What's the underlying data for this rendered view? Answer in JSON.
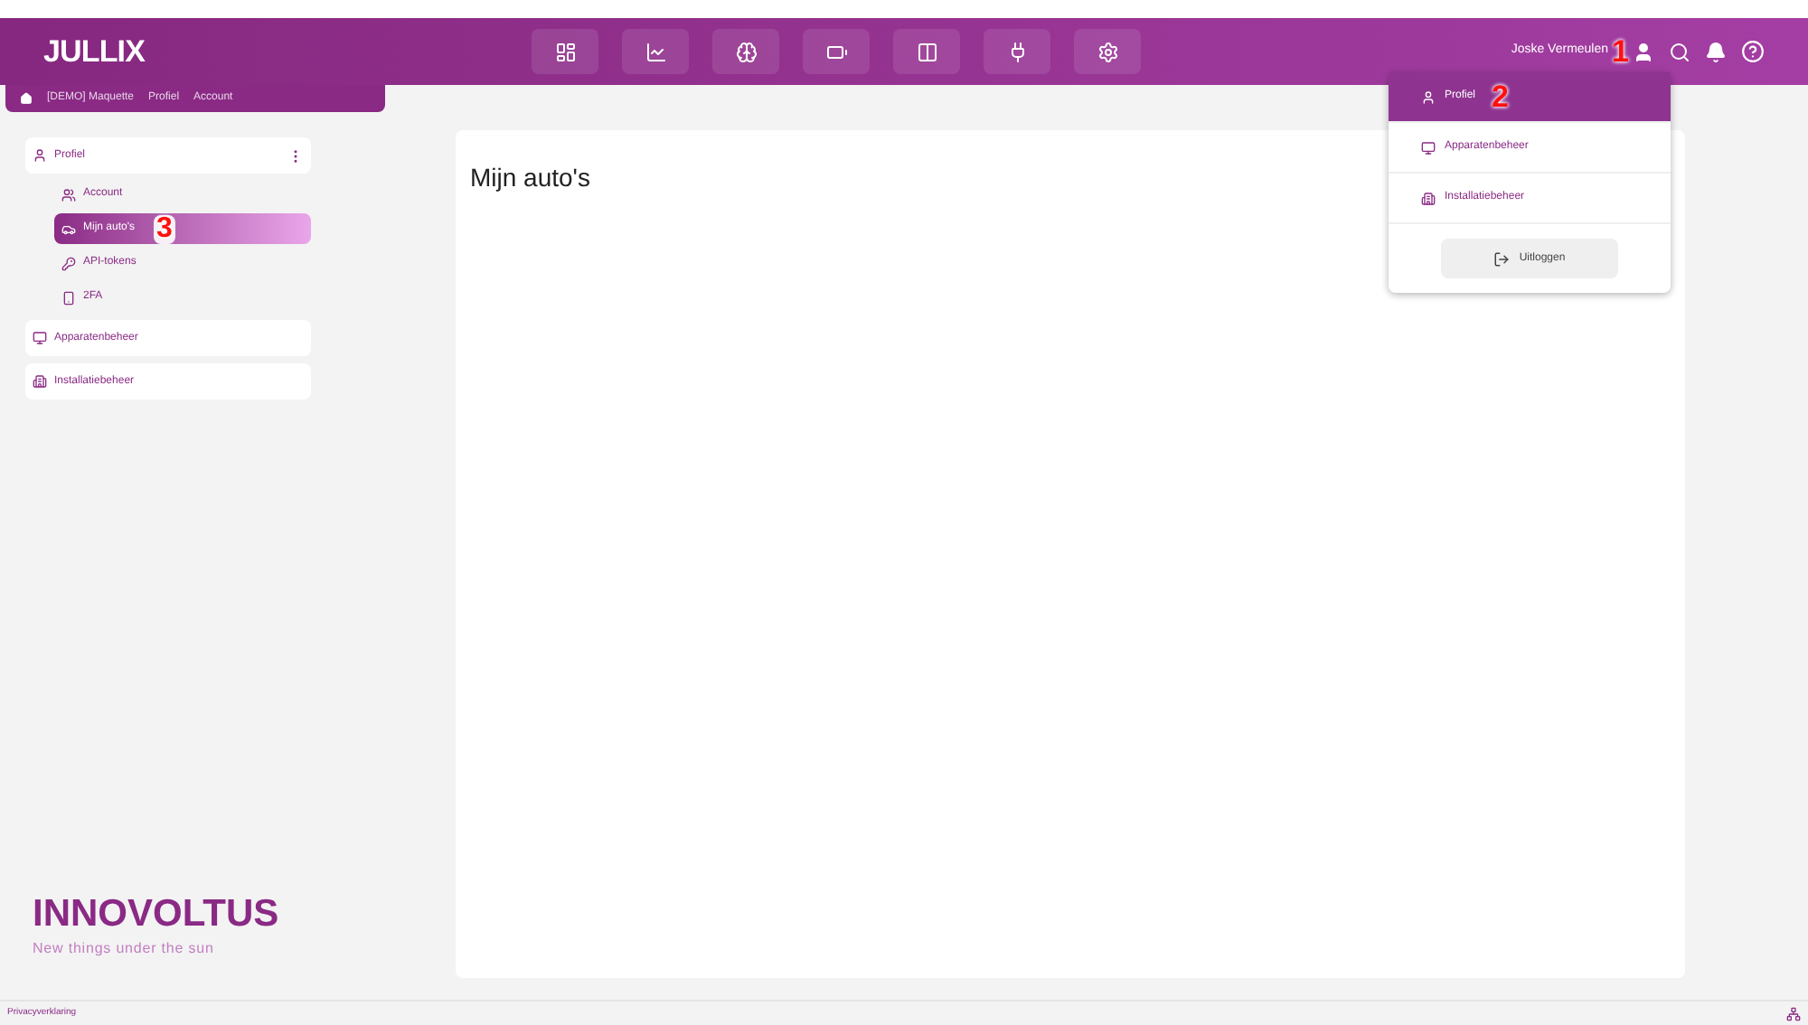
{
  "header": {
    "logo": "JULLIX",
    "nav": [
      {
        "selected": false
      },
      {
        "selected": false
      },
      {
        "selected": false
      },
      {
        "selected": false
      },
      {
        "selected": false
      },
      {
        "selected": false
      },
      {
        "selected": false
      }
    ],
    "user_name": "Joske Vermeulen"
  },
  "breadcrumb": [
    "[DEMO] Maquette",
    "Profiel",
    "Account"
  ],
  "sidebar": {
    "items": [
      {
        "label": "Profiel",
        "expanded": true,
        "children": [
          {
            "label": "Account",
            "selected": false
          },
          {
            "label": "Mijn auto's",
            "selected": true
          },
          {
            "label": "API-tokens",
            "selected": false
          },
          {
            "label": "2FA",
            "selected": false
          }
        ]
      },
      {
        "label": "Apparatenbeheer",
        "expanded": false
      },
      {
        "label": "Installatiebeheer",
        "expanded": false
      }
    ],
    "brand": "INNOVOLTUS",
    "tagline": "New things under the sun"
  },
  "main": {
    "title": "Mijn auto's"
  },
  "user_menu": {
    "items": [
      {
        "label": "Profiel",
        "selected": true
      },
      {
        "label": "Apparatenbeheer",
        "selected": false
      },
      {
        "label": "Installatiebeheer",
        "selected": false
      }
    ],
    "logout": "Uitloggen"
  },
  "annotations": [
    "1",
    "2",
    "3"
  ],
  "footer": {
    "link": "Privacyverklaring"
  }
}
